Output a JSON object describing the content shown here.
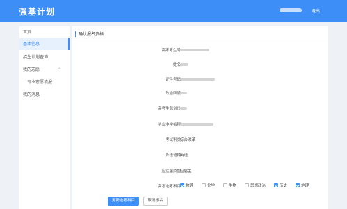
{
  "header": {
    "brand": "强基计划",
    "logout_label": "退出"
  },
  "sidebar": {
    "items": [
      {
        "label": "首页"
      },
      {
        "label": "基本信息"
      },
      {
        "label": "招生计划查询"
      },
      {
        "label": "我的志愿"
      },
      {
        "label": "专业志愿填报"
      },
      {
        "label": "我的消息"
      }
    ]
  },
  "form": {
    "title": "确认报名资格",
    "labels": {
      "exam_id": "高考考生号",
      "name": "姓名",
      "id_number": "证件号码",
      "political": "政治面貌",
      "province": "高考生源省份",
      "school": "毕业中学名称",
      "exam_type": "考试科类",
      "language": "外语语种",
      "grad_type": "应往届类型",
      "subjects": "高考选考科目"
    },
    "values": {
      "exam_type": "综合改革",
      "language": "英语",
      "grad_type": "应届生"
    },
    "subjects": [
      {
        "label": "物理",
        "checked": true
      },
      {
        "label": "化学",
        "checked": false
      },
      {
        "label": "生物",
        "checked": false
      },
      {
        "label": "思想政治",
        "checked": false
      },
      {
        "label": "历史",
        "checked": true
      },
      {
        "label": "地理",
        "checked": true
      }
    ],
    "buttons": {
      "update": "更新选考科目",
      "cancel": "取消报名"
    }
  }
}
